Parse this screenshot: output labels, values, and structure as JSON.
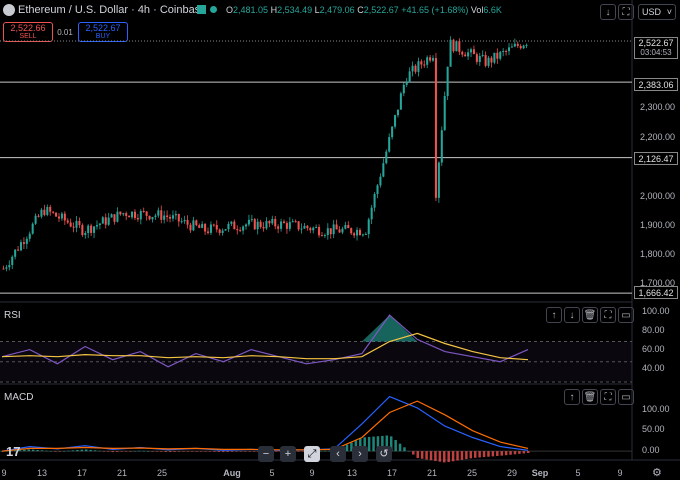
{
  "legend": {
    "title": "Ethereum / U.S. Dollar · 4h · Coinbase",
    "o_label": "O",
    "o_value": "2,481.05",
    "h_label": "H",
    "h_value": "2,534.49",
    "l_label": "L",
    "l_value": "2,479.06",
    "c_label": "C",
    "c_value": "2,522.67",
    "change": "+41.65 (+1.68%)",
    "vol_label": "Vol",
    "vol_value": "6.6K",
    "currency": "USD"
  },
  "trade": {
    "sell_price": "2,522.66",
    "sell_label": "SELL",
    "spread": "0.01",
    "buy_price": "2,522.67",
    "buy_label": "BUY"
  },
  "price_axis": {
    "ticks": [
      "2,300.00",
      "2,200.00",
      "2,000.00",
      "1,900.00",
      "1,800.00",
      "1,700.00"
    ],
    "current_price": "2,522.67",
    "countdown": "03:04:53",
    "levels": [
      "2,383.06",
      "2,126.47",
      "1,666.42"
    ]
  },
  "rsi": {
    "label": "RSI",
    "ticks": [
      "100.00",
      "80.00",
      "60.00",
      "40.00"
    ]
  },
  "macd": {
    "label": "MACD",
    "ticks": [
      "100.00",
      "50.00",
      "0.00"
    ]
  },
  "time_axis": {
    "labels": [
      "9",
      "13",
      "17",
      "21",
      "25",
      "Aug",
      "5",
      "9",
      "13",
      "17",
      "21",
      "25",
      "29",
      "Sep",
      "5",
      "9"
    ]
  },
  "colors": {
    "up": "#26a69a",
    "down": "#ef5350",
    "rsi_line": "#7e57c2",
    "rsi_ma": "#f5c542",
    "macd_line": "#2962ff",
    "signal_line": "#ff6d00",
    "sell": "#ef5350",
    "buy": "#2962ff"
  },
  "chart_data": [
    {
      "type": "candlestick",
      "symbol": "Ethereum / U.S. Dollar",
      "interval": "4h",
      "x": [
        "9",
        "13",
        "17",
        "21",
        "25",
        "Aug",
        "5",
        "9",
        "13",
        "17",
        "21",
        "25",
        "29"
      ],
      "close": [
        1750,
        1950,
        1880,
        1940,
        1930,
        1880,
        1900,
        1900,
        1880,
        1880,
        2400,
        2520,
        2450,
        2522.67
      ],
      "ylim": [
        1650,
        2560
      ],
      "levels": [
        2383.06,
        2126.47,
        1666.42
      ]
    },
    {
      "type": "line",
      "title": "RSI",
      "ylim": [
        30,
        105
      ],
      "series": [
        {
          "values": [
            55,
            62,
            48,
            65,
            52,
            60,
            45,
            58,
            50,
            62,
            55,
            48,
            52,
            58,
            96,
            72,
            60,
            55,
            50,
            62
          ]
        },
        {
          "values": [
            55,
            56,
            55,
            57,
            56,
            56,
            54,
            55,
            54,
            56,
            55,
            53,
            53,
            55,
            70,
            78,
            68,
            60,
            54,
            52
          ]
        }
      ]
    },
    {
      "type": "line",
      "title": "MACD",
      "ylim": [
        -15,
        130
      ],
      "series": [
        {
          "values": [
            0,
            10,
            5,
            12,
            4,
            8,
            3,
            6,
            2,
            4,
            2,
            3,
            5,
            60,
            120,
            95,
            55,
            30,
            10,
            2
          ]
        },
        {
          "values": [
            0,
            6,
            6,
            8,
            6,
            7,
            5,
            6,
            4,
            4,
            3,
            3,
            4,
            30,
            85,
            110,
            80,
            45,
            20,
            6
          ]
        }
      ]
    }
  ]
}
